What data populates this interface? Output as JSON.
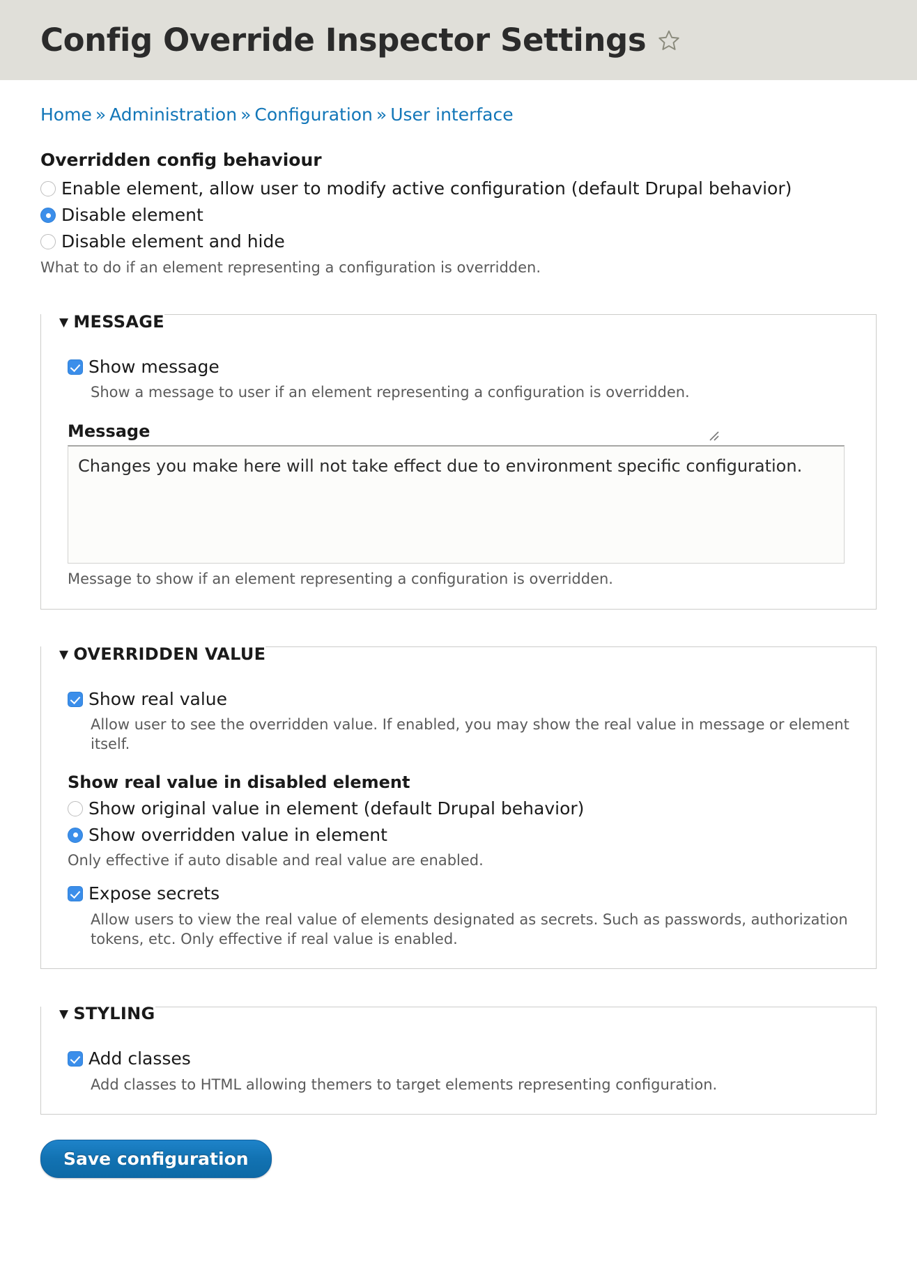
{
  "header": {
    "title": "Config Override Inspector Settings",
    "star_icon": "star-outline-icon",
    "background_color": "#e0dfd9"
  },
  "breadcrumb": {
    "separator": "»",
    "items": [
      {
        "label": "Home"
      },
      {
        "label": "Administration"
      },
      {
        "label": "Configuration"
      },
      {
        "label": "User interface"
      }
    ],
    "link_color": "#1276b8"
  },
  "behaviour": {
    "label": "Overridden config behaviour",
    "options": [
      {
        "label": "Enable element, allow user to modify active configuration (default Drupal behavior)",
        "selected": false
      },
      {
        "label": "Disable element",
        "selected": true
      },
      {
        "label": "Disable element and hide",
        "selected": false
      }
    ],
    "description": "What to do if an element representing a configuration is overridden."
  },
  "message_panel": {
    "legend": "MESSAGE",
    "toggle_icon": "▼",
    "show_message": {
      "label": "Show message",
      "checked": true,
      "description": "Show a message to user if an element representing a configuration is overridden."
    },
    "message_field": {
      "label": "Message",
      "value": "Changes you make here will not take effect due to environment specific configuration.",
      "description": "Message to show if an element representing a configuration is overridden.",
      "resize_handle": "resize-grip-icon"
    }
  },
  "overridden_value_panel": {
    "legend": "OVERRIDDEN VALUE",
    "toggle_icon": "▼",
    "show_real_value": {
      "label": "Show real value",
      "checked": true,
      "description": "Allow user to see the overridden value. If enabled, you may show the real value in message or element itself."
    },
    "show_real_value_in_disabled_element": {
      "label": "Show real value in disabled element",
      "options": [
        {
          "label": "Show original value in element (default Drupal behavior)",
          "selected": false
        },
        {
          "label": "Show overridden value in element",
          "selected": true
        }
      ],
      "description": "Only effective if auto disable and real value are enabled."
    },
    "expose_secrets": {
      "label": "Expose secrets",
      "checked": true,
      "description": "Allow users to view the real value of elements designated as secrets. Such as passwords, authorization tokens, etc. Only effective if real value is enabled."
    }
  },
  "styling_panel": {
    "legend": "STYLING",
    "toggle_icon": "▼",
    "add_classes": {
      "label": "Add classes",
      "checked": true,
      "description": "Add classes to HTML allowing themers to target elements representing configuration."
    }
  },
  "actions": {
    "save_label": "Save configuration",
    "accent_color": "#1272b2"
  }
}
